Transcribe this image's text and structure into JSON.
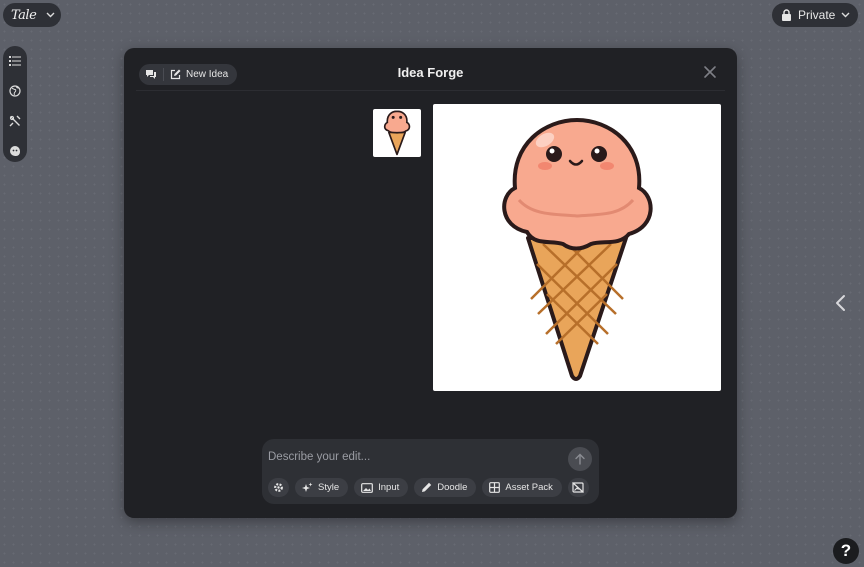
{
  "topbar": {
    "logo_text": "Tale",
    "privacy_label": "Private"
  },
  "left_toolbar": {
    "tools": [
      "list-icon",
      "globe-icon",
      "tools-icon",
      "sticker-icon"
    ]
  },
  "modal": {
    "title": "Idea Forge",
    "new_idea_label": "New Idea",
    "icons": {
      "chat": "chat-bubbles-icon",
      "new_idea": "pencil-square-icon",
      "close": "close-icon"
    }
  },
  "prompt": {
    "placeholder": "Describe your edit...",
    "value": "",
    "chips": {
      "style": "Style",
      "input": "Input",
      "doodle": "Doodle",
      "asset_pack": "Asset Pack"
    }
  },
  "help": {
    "label": "?"
  },
  "colors": {
    "page_bg": "#5d6069",
    "panel_bg": "#202125",
    "pill_bg": "#34363c",
    "ice_cream": "#f8a98f",
    "cone": "#e9a55a",
    "outline": "#2a1a1a"
  }
}
